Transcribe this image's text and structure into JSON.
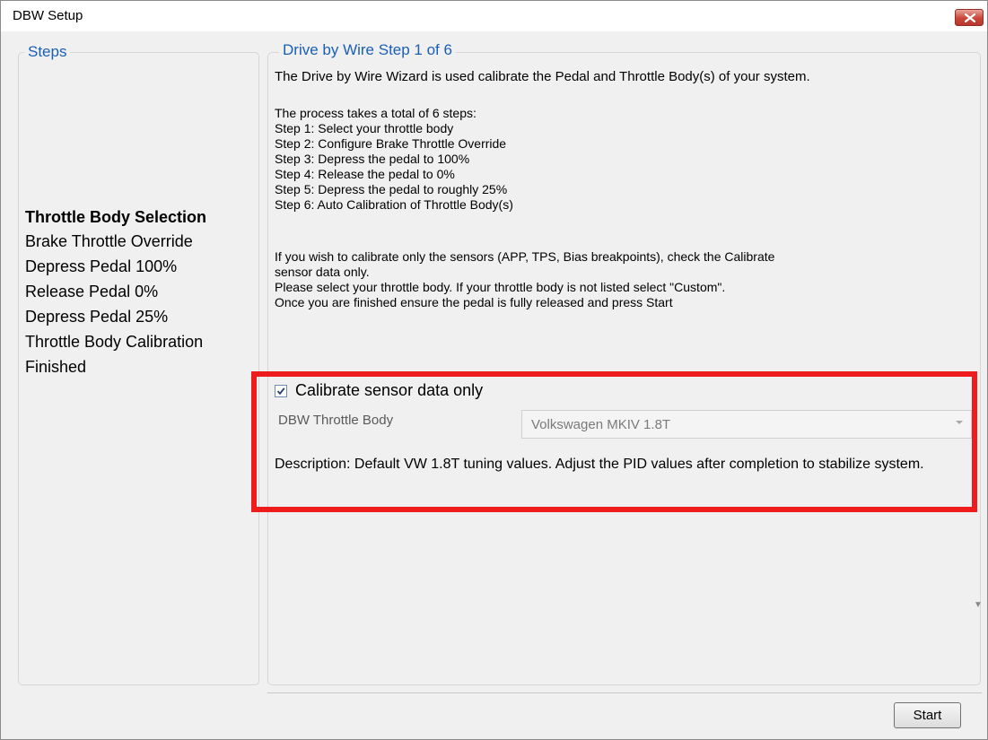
{
  "window": {
    "title": "DBW Setup",
    "close_icon": "close-icon"
  },
  "steps_panel": {
    "title": "Steps",
    "items": [
      {
        "label": "Throttle Body Selection",
        "active": true
      },
      {
        "label": "Brake Throttle Override",
        "active": false
      },
      {
        "label": "Depress Pedal 100%",
        "active": false
      },
      {
        "label": "Release Pedal 0%",
        "active": false
      },
      {
        "label": "Depress Pedal 25%",
        "active": false
      },
      {
        "label": "Throttle Body Calibration",
        "active": false
      },
      {
        "label": "Finished",
        "active": false
      }
    ]
  },
  "wizard": {
    "title": "Drive by Wire Step 1 of 6",
    "intro": "The Drive by Wire Wizard is used calibrate the Pedal and Throttle Body(s) of your system.",
    "process_heading": "The process takes a total of 6 steps:",
    "step_lines": [
      "Step 1: Select your throttle body",
      "Step 2: Configure Brake Throttle Override",
      "Step 3: Depress the pedal to 100%",
      "Step 4: Release the pedal to 0%",
      "Step 5: Depress the pedal to roughly 25%",
      "Step 6: Auto Calibration of Throttle Body(s)"
    ],
    "calibrate_note_line1": "If you wish to calibrate only the sensors (APP, TPS, Bias breakpoints), check the Calibrate",
    "calibrate_note_line2": "sensor data only.",
    "select_note": "Please select your throttle body. If your throttle body is not listed select \"Custom\".",
    "finish_note": "Once you are finished ensure the pedal is fully released and press Start",
    "checkbox": {
      "label": "Calibrate sensor data only",
      "checked": true
    },
    "throttle_body": {
      "label": "DBW Throttle Body",
      "value": "Volkswagen MKIV 1.8T"
    },
    "description": "Description: Default VW 1.8T tuning values. Adjust the PID values after completion to stabilize system."
  },
  "footer": {
    "start_label": "Start"
  },
  "colors": {
    "group_title": "#1a5fb4",
    "highlight": "#ee1c1c",
    "close_button": "#c9463a"
  }
}
